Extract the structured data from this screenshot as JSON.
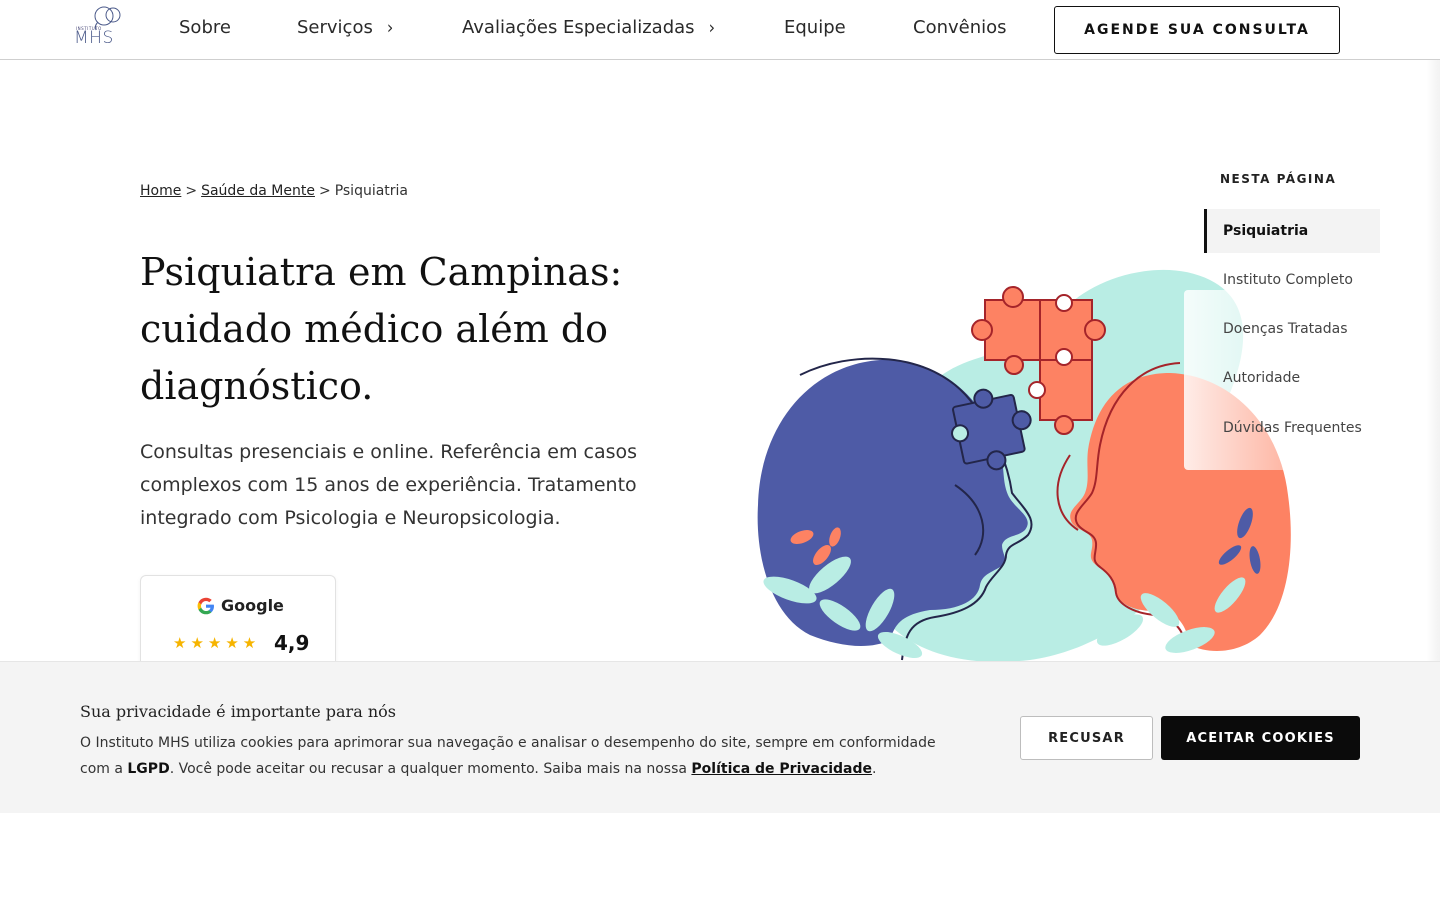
{
  "header": {
    "logo_small": "INSTITUTO",
    "logo_main": "MHS",
    "nav": [
      {
        "label": "Sobre"
      },
      {
        "label": "Serviços"
      },
      {
        "label": "Avaliações Especializadas"
      },
      {
        "label": "Equipe"
      },
      {
        "label": "Convênios"
      }
    ],
    "chevron": "›",
    "cta_label": "AGENDE SUA CONSULTA"
  },
  "breadcrumb": {
    "items": [
      "Home",
      "Saúde da Mente",
      "Psiquiatria"
    ],
    "separator": ">"
  },
  "main": {
    "title": "Psiquiatra em Campinas: cuidado médico além do diagnóstico.",
    "subtitle": "Consultas presenciais e online. Referência em casos complexos com 15 anos de experiência. Tratamento integrado com Psicologia e Neuropsicologia."
  },
  "google_card": {
    "label": "Google",
    "stars": "★★★★★",
    "rating": "4,9",
    "rating_value": 4.9
  },
  "toc": {
    "heading": "NESTA PÁGINA",
    "items": [
      {
        "label": "Psiquiatria"
      },
      {
        "label": "Instituto Completo"
      },
      {
        "label": "Doenças Tratadas"
      },
      {
        "label": "Autoridade"
      },
      {
        "label": "Dúvidas Frequentes"
      }
    ]
  },
  "cookie": {
    "title": "Sua privacidade é importante para nós",
    "text_1": "O Instituto MHS utiliza cookies para aprimorar sua navegação e analisar o desempenho do site, sempre em conformidade com a ",
    "text_lgpd": "LGPD",
    "text_2": ". Você pode aceitar ou recusar a qualquer momento. Saiba mais na nossa ",
    "link": "Política de Privacidade",
    "text_3": ".",
    "decline_label": "RECUSAR",
    "accept_label": "ACEITAR COOKIES"
  },
  "colors": {
    "indigo": "#4e5ba6",
    "coral": "#fd8263",
    "mint": "#b9ede4",
    "dark": "#111111"
  }
}
